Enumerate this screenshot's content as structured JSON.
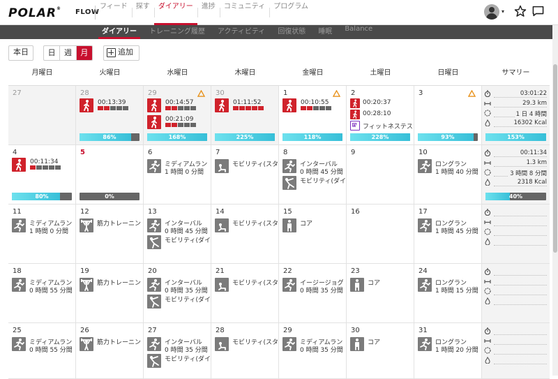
{
  "brand": {
    "logo": "POLAR",
    "product": "FLOW"
  },
  "main_nav": [
    {
      "label": "フィード",
      "active": false
    },
    {
      "label": "探す",
      "active": false
    },
    {
      "label": "ダイアリー",
      "active": true
    },
    {
      "label": "進捗",
      "active": false
    },
    {
      "label": "コミュニティ",
      "active": false
    },
    {
      "label": "プログラム",
      "active": false
    }
  ],
  "header_icons": {
    "avatar": "user-avatar-icon",
    "caret": "▾",
    "star": "star-icon",
    "chat": "chat-icon"
  },
  "sub_nav": [
    {
      "label": "ダイアリー",
      "active": true
    },
    {
      "label": "トレーニング履歴",
      "active": false
    },
    {
      "label": "アクティビティ",
      "active": false
    },
    {
      "label": "回復状態",
      "active": false
    },
    {
      "label": "睡眠",
      "active": false
    },
    {
      "label": "Balance",
      "active": false
    }
  ],
  "toolbar": {
    "today": "本日",
    "views": [
      "日",
      "週",
      "月"
    ],
    "active_view": "月",
    "add": "追加"
  },
  "day_headers": [
    "月曜日",
    "火曜日",
    "水曜日",
    "木曜日",
    "金曜日",
    "土曜日",
    "日曜日",
    "サマリー"
  ],
  "colors": {
    "brand_red": "#c8102e",
    "zone_red": "#d0222b",
    "progress_cyan": "#37bfd8",
    "icon_gray": "#7b7b7b"
  },
  "weeks": [
    {
      "days": [
        {
          "date": "27",
          "past": true,
          "entries": [],
          "progress": null
        },
        {
          "date": "28",
          "past": true,
          "entries": [
            {
              "kind": "done",
              "icon": "walking-icon",
              "time": "00:13:39",
              "zones": 2
            }
          ],
          "progress": {
            "label": "86%",
            "value": 0.86
          }
        },
        {
          "date": "29",
          "past": true,
          "warning": true,
          "entries": [
            {
              "kind": "done",
              "icon": "walking-icon",
              "time": "00:14:57",
              "zones": 2
            },
            {
              "kind": "done",
              "icon": "walking-icon",
              "time": "00:21:09",
              "zones": 2
            }
          ],
          "progress": {
            "label": "168%",
            "value": 1
          }
        },
        {
          "date": "30",
          "past": true,
          "entries": [
            {
              "kind": "done",
              "icon": "walking-icon",
              "time": "01:11:52",
              "zones": 5
            }
          ],
          "progress": {
            "label": "225%",
            "value": 1
          }
        },
        {
          "date": "1",
          "past": false,
          "warning": true,
          "entries": [
            {
              "kind": "done",
              "icon": "walking-icon",
              "time": "00:10:55",
              "zones": 2
            }
          ],
          "progress": {
            "label": "118%",
            "value": 1
          }
        },
        {
          "date": "2",
          "past": false,
          "entries": [
            {
              "kind": "small",
              "icon": "walking-icon",
              "time": "00:20:37"
            },
            {
              "kind": "small",
              "icon": "walking-icon",
              "time": "00:28:10"
            },
            {
              "kind": "fitness",
              "icon": "fitness-test-icon",
              "time": "フィットネステス"
            }
          ],
          "progress": {
            "label": "228%",
            "value": 1
          }
        },
        {
          "date": "3",
          "past": false,
          "warning": true,
          "entries": [],
          "progress": {
            "label": "93%",
            "value": 0.93
          }
        }
      ],
      "summary": {
        "duration": "03:01:22",
        "distance": "29.3 km",
        "sessions": "1 日 4 時間",
        "calories": "16302 Kcal",
        "progress": {
          "label": "153%",
          "value": 1
        }
      }
    },
    {
      "days": [
        {
          "date": "4",
          "past": false,
          "entries": [
            {
              "kind": "done",
              "icon": "walking-icon",
              "time": "00:11:34",
              "zones": 1
            }
          ],
          "progress": {
            "label": "80%",
            "value": 0.8
          }
        },
        {
          "date": "5",
          "today": true,
          "past": false,
          "entries": [],
          "progress": {
            "label": "0%",
            "value": 0
          }
        },
        {
          "date": "6",
          "entries": [
            {
              "kind": "plan",
              "icon": "running-icon",
              "name": "ミディアムラン",
              "dur": "1 時間 0 分間"
            }
          ]
        },
        {
          "date": "7",
          "entries": [
            {
              "kind": "plan",
              "icon": "mobility-icon",
              "name": "モビリティ(スタ",
              "dur": ""
            }
          ]
        },
        {
          "date": "8",
          "entries": [
            {
              "kind": "plan",
              "icon": "running-icon",
              "name": "インターバル",
              "dur": "0 時間 45 分間"
            },
            {
              "kind": "plan",
              "icon": "stretching-icon",
              "name": "モビリティ(ダイ",
              "dur": ""
            }
          ]
        },
        {
          "date": "9",
          "entries": []
        },
        {
          "date": "10",
          "entries": [
            {
              "kind": "plan",
              "icon": "running-icon",
              "name": "ロングラン",
              "dur": "1 時間 40 分間"
            }
          ]
        }
      ],
      "summary": {
        "duration": "00:11:34",
        "distance": "1.3 km",
        "sessions": "3 時間 8 分間",
        "calories": "2318 Kcal",
        "progress": {
          "label": "40%",
          "value": 0.4
        }
      }
    },
    {
      "days": [
        {
          "date": "11",
          "entries": [
            {
              "kind": "plan",
              "icon": "running-icon",
              "name": "ミディアムラン",
              "dur": "1 時間 0 分間"
            }
          ]
        },
        {
          "date": "12",
          "entries": [
            {
              "kind": "plan",
              "icon": "strength-icon",
              "name": "筋力トレーニン",
              "dur": ""
            }
          ]
        },
        {
          "date": "13",
          "entries": [
            {
              "kind": "plan",
              "icon": "running-icon",
              "name": "インターバル",
              "dur": "0 時間 45 分間"
            },
            {
              "kind": "plan",
              "icon": "stretching-icon",
              "name": "モビリティ(ダイ",
              "dur": ""
            }
          ]
        },
        {
          "date": "14",
          "entries": [
            {
              "kind": "plan",
              "icon": "mobility-icon",
              "name": "モビリティ(スタ",
              "dur": ""
            }
          ]
        },
        {
          "date": "15",
          "entries": [
            {
              "kind": "plan",
              "icon": "core-icon",
              "name": "コア",
              "dur": ""
            }
          ]
        },
        {
          "date": "16",
          "entries": []
        },
        {
          "date": "17",
          "entries": [
            {
              "kind": "plan",
              "icon": "running-icon",
              "name": "ロングラン",
              "dur": "1 時間 45 分間"
            }
          ]
        }
      ],
      "summary": null
    },
    {
      "days": [
        {
          "date": "18",
          "entries": [
            {
              "kind": "plan",
              "icon": "running-icon",
              "name": "ミディアムラン",
              "dur": "0 時間 55 分間"
            }
          ]
        },
        {
          "date": "19",
          "entries": [
            {
              "kind": "plan",
              "icon": "strength-icon",
              "name": "筋力トレーニン",
              "dur": ""
            }
          ]
        },
        {
          "date": "20",
          "entries": [
            {
              "kind": "plan",
              "icon": "running-icon",
              "name": "インターバル",
              "dur": "0 時間 35 分間"
            },
            {
              "kind": "plan",
              "icon": "stretching-icon",
              "name": "モビリティ(ダイ",
              "dur": ""
            }
          ]
        },
        {
          "date": "21",
          "entries": [
            {
              "kind": "plan",
              "icon": "mobility-icon",
              "name": "モビリティ(スタ",
              "dur": ""
            }
          ]
        },
        {
          "date": "22",
          "entries": [
            {
              "kind": "plan",
              "icon": "running-icon",
              "name": "イージージョグ",
              "dur": "0 時間 35 分間"
            }
          ]
        },
        {
          "date": "23",
          "entries": [
            {
              "kind": "plan",
              "icon": "core-icon",
              "name": "コア",
              "dur": ""
            }
          ]
        },
        {
          "date": "24",
          "entries": [
            {
              "kind": "plan",
              "icon": "running-icon",
              "name": "ロングラン",
              "dur": "1 時間 15 分間"
            }
          ]
        }
      ],
      "summary": null
    },
    {
      "days": [
        {
          "date": "25",
          "entries": [
            {
              "kind": "plan",
              "icon": "running-icon",
              "name": "ミディアムラン",
              "dur": "0 時間 55 分間"
            }
          ]
        },
        {
          "date": "26",
          "entries": [
            {
              "kind": "plan",
              "icon": "strength-icon",
              "name": "筋力トレーニン",
              "dur": ""
            }
          ]
        },
        {
          "date": "27",
          "entries": [
            {
              "kind": "plan",
              "icon": "running-icon",
              "name": "インターバル",
              "dur": "0 時間 35 分間"
            },
            {
              "kind": "plan",
              "icon": "stretching-icon",
              "name": "モビリティ(ダイ",
              "dur": ""
            }
          ]
        },
        {
          "date": "28",
          "entries": [
            {
              "kind": "plan",
              "icon": "mobility-icon",
              "name": "モビリティ(スタ",
              "dur": ""
            }
          ]
        },
        {
          "date": "29",
          "entries": [
            {
              "kind": "plan",
              "icon": "running-icon",
              "name": "ミディアムラン",
              "dur": "0 時間 35 分間"
            }
          ]
        },
        {
          "date": "30",
          "entries": [
            {
              "kind": "plan",
              "icon": "core-icon",
              "name": "コア",
              "dur": ""
            }
          ]
        },
        {
          "date": "31",
          "entries": [
            {
              "kind": "plan",
              "icon": "running-icon",
              "name": "ロングラン",
              "dur": "1 時間 20 分間"
            }
          ]
        }
      ],
      "summary": null
    }
  ]
}
